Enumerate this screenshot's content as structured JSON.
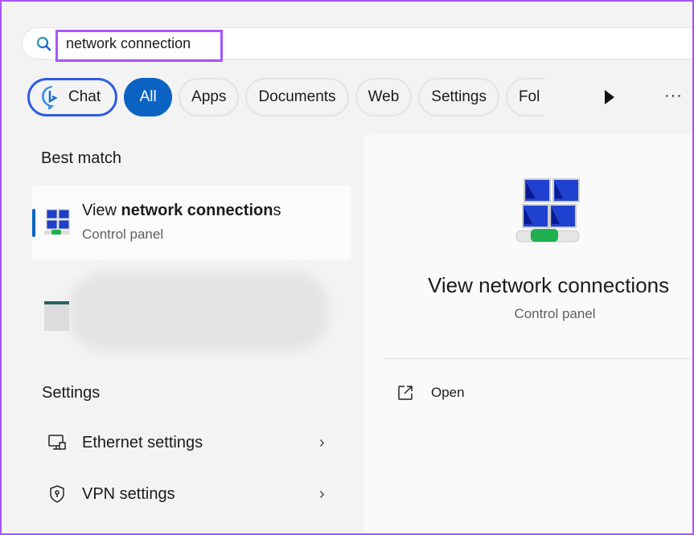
{
  "search": {
    "value": "network connection",
    "icon": "search-icon"
  },
  "filters": {
    "chat": "Chat",
    "all": "All",
    "apps": "Apps",
    "documents": "Documents",
    "web": "Web",
    "settings": "Settings",
    "folders": "Fol"
  },
  "best_match": {
    "heading": "Best match",
    "title_prefix": "View ",
    "title_bold": "network connection",
    "title_suffix": "s",
    "subtitle": "Control panel"
  },
  "settings": {
    "heading": "Settings",
    "items": [
      {
        "label": "Ethernet settings",
        "icon": "ethernet-icon"
      },
      {
        "label": "VPN settings",
        "icon": "shield-icon"
      }
    ]
  },
  "detail": {
    "title": "View network connections",
    "subtitle": "Control panel",
    "open_label": "Open"
  },
  "colors": {
    "accent": "#0a63c2",
    "highlight": "#a855f7"
  }
}
